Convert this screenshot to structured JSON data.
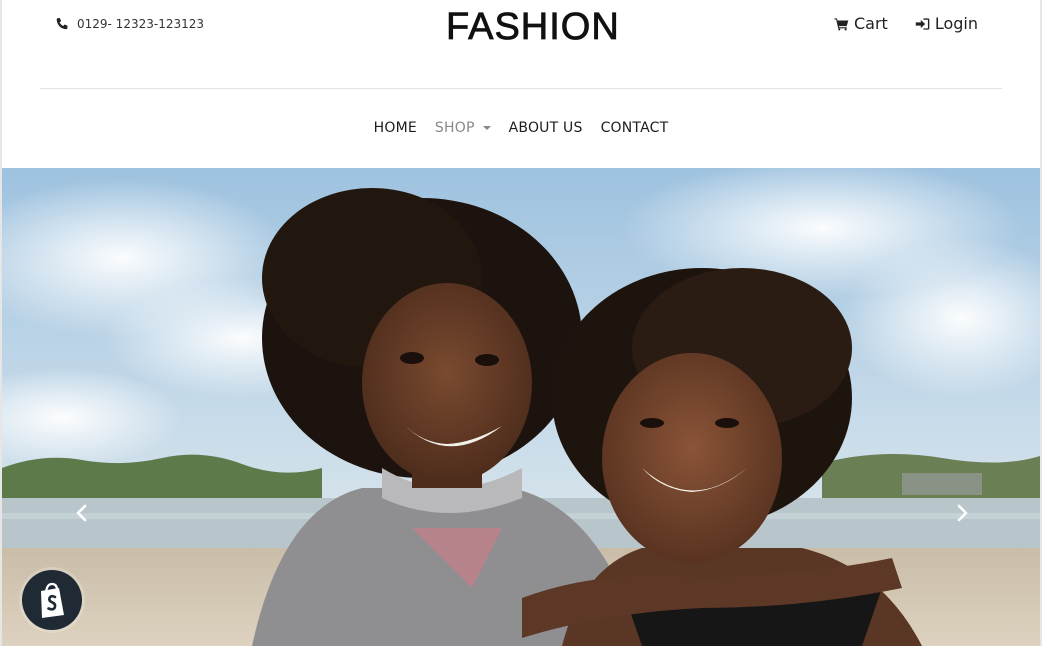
{
  "header": {
    "phone": "0129- 12323-123123",
    "logo_text": "FASHION",
    "cart_label": "Cart",
    "login_label": "Login"
  },
  "nav": {
    "items": [
      {
        "label": "HOME"
      },
      {
        "label": "SHOP"
      },
      {
        "label": "ABOUT US"
      },
      {
        "label": "CONTACT"
      }
    ]
  },
  "carousel": {
    "prev_label": "Previous",
    "next_label": "Next"
  },
  "icons": {
    "phone": "phone-icon",
    "cart": "shopping-cart-icon",
    "login": "sign-in-icon",
    "prev": "chevron-left-icon",
    "next": "chevron-right-icon",
    "shop_badge": "shopify-bag-icon"
  },
  "colors": {
    "text": "#222222",
    "nav_muted": "#888888",
    "badge_bg": "#1f2a35"
  }
}
